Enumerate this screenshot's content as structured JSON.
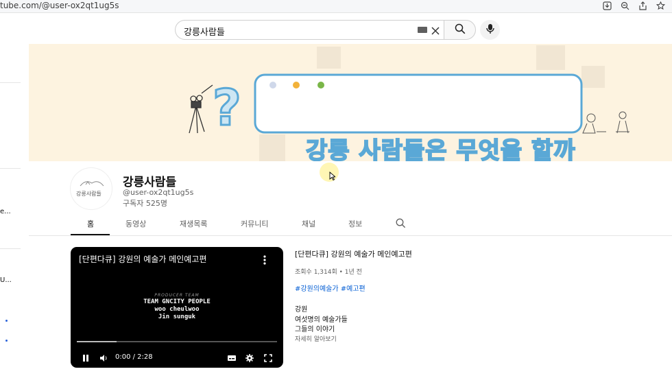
{
  "browser": {
    "url": "tube.com/@user-ox2qt1ug5s",
    "icons": [
      "download-icon",
      "zoom-icon",
      "share-icon",
      "star-icon"
    ]
  },
  "sidebar": {
    "fragments": [
      "e...",
      "U..."
    ]
  },
  "search": {
    "query": "강릉사람들"
  },
  "banner": {
    "title": "강릉 사람들은 무엇을 할까",
    "colors": {
      "background": "#fdf3e0",
      "accent": "#5aa8d6"
    }
  },
  "channel": {
    "avatar_text": "강릉사람들",
    "name": "강릉사람들",
    "handle": "@user-ox2qt1ug5s",
    "subscribers": "구독자 525명"
  },
  "tabs": [
    {
      "label": "홈",
      "active": true
    },
    {
      "label": "동영상",
      "active": false
    },
    {
      "label": "재생목록",
      "active": false
    },
    {
      "label": "커뮤니티",
      "active": false
    },
    {
      "label": "채널",
      "active": false
    },
    {
      "label": "정보",
      "active": false
    }
  ],
  "video": {
    "player_title": "[단편다큐] 강원의 예술가 메인예고편",
    "credits": {
      "heading": "PRODUCER TEAM",
      "line1": "TEAM GNCITY PEOPLE",
      "line2": "woo cheulwoo",
      "line3": "Jin sunguk"
    },
    "time": "0:00 / 2:28",
    "progress": 0.2,
    "title": "[단편다큐] 강원의 예술가 메인예고편",
    "meta": "조회수 1,314회 • 1년 전",
    "tags": "#강원의예술가 #예고편",
    "description": [
      "강원",
      "여섯명의 예술가들",
      "그들의 이야기"
    ],
    "more": "자세히 알아보기"
  }
}
